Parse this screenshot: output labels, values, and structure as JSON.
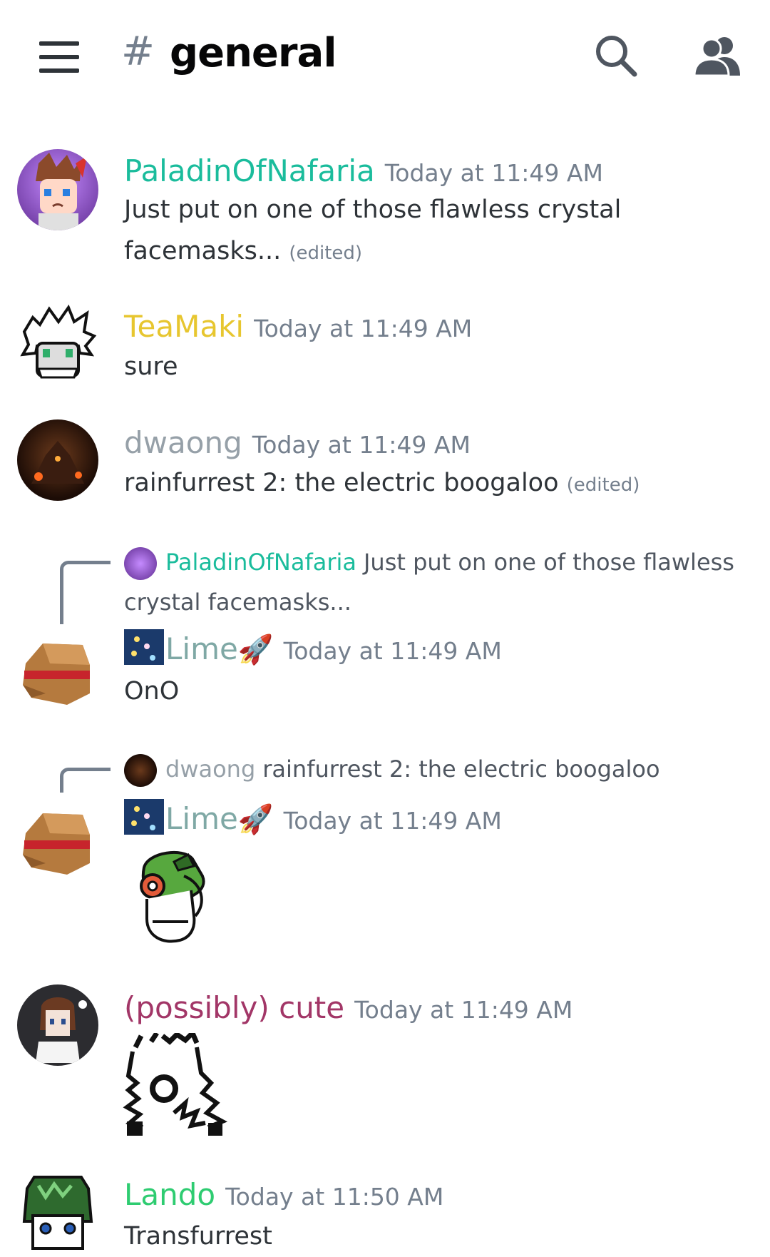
{
  "channel": {
    "hash": "#",
    "name": "general"
  },
  "messages": [
    {
      "author": "PaladinOfNafaria",
      "color": "#1abc9c",
      "time": "Today at 11:49 AM",
      "text": "Just put on one of those flawless crystal facemasks...",
      "edited": "(edited)"
    },
    {
      "author": "TeaMaki",
      "color": "#e7c62f",
      "time": "Today at 11:49 AM",
      "text": "sure"
    },
    {
      "author": "dwaong",
      "color": "#96a0a8",
      "time": "Today at 11:49 AM",
      "text": "rainfurrest 2: the electric boogaloo",
      "edited": "(edited)"
    },
    {
      "reply": {
        "author": "PaladinOfNafaria",
        "text": "Just put on one of those flawless crystal facemasks..."
      },
      "author": "Lime",
      "author_prefix_emoji": "fireworks-emoji",
      "author_suffix_emoji": "🚀",
      "color": "#7fa8a5",
      "time": "Today at 11:49 AM",
      "text": "OnO"
    },
    {
      "reply": {
        "author": "dwaong",
        "text": "rainfurrest 2: the electric boogaloo"
      },
      "author": "Lime",
      "author_prefix_emoji": "fireworks-emoji",
      "author_suffix_emoji": "🚀",
      "color": "#7fa8a5",
      "time": "Today at 11:49 AM",
      "content": "alien-sticker-image"
    },
    {
      "author": "(possibly) cute",
      "color": "#a23667",
      "time": "Today at 11:49 AM",
      "content": "doodle-sticker-image"
    },
    {
      "author": "Lando",
      "color": "#2ecc71",
      "time": "Today at 11:50 AM",
      "text": "Transfurrest"
    }
  ]
}
